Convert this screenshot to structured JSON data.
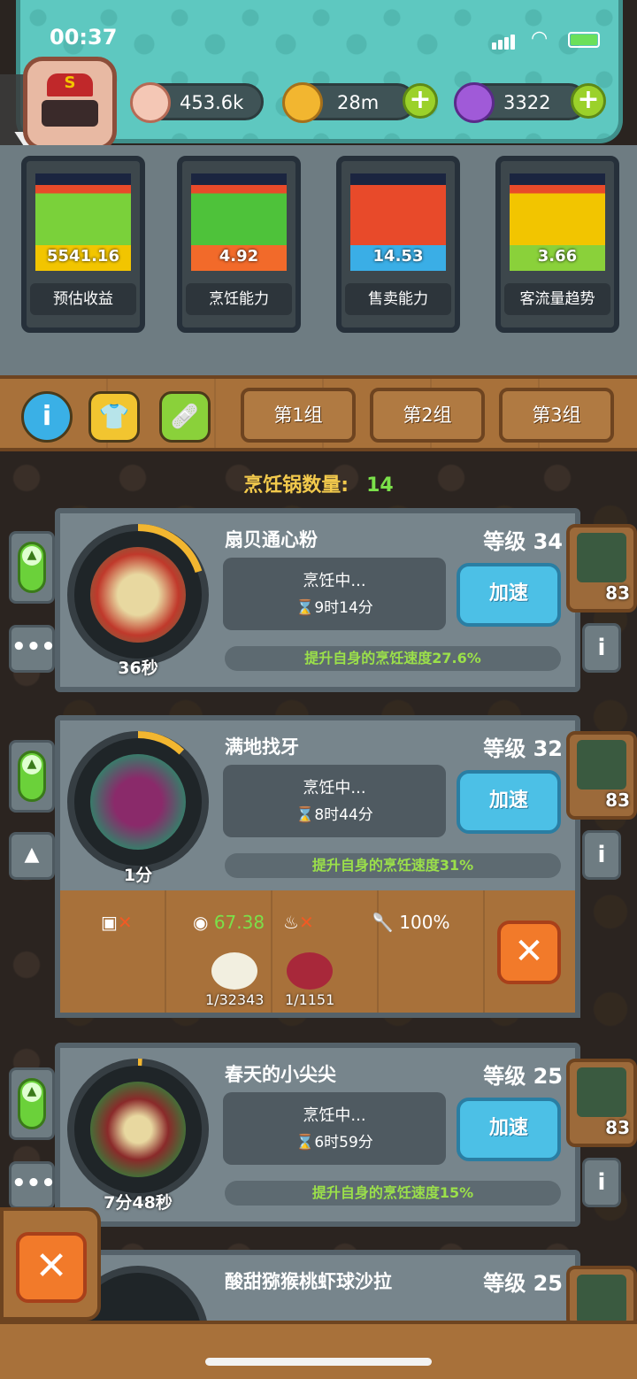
{
  "status_bar": {
    "time": "00:37"
  },
  "resources": [
    {
      "name": "eyeball",
      "icon": "eyeball-icon",
      "value": "453.6k",
      "color": "#f4c7b5"
    },
    {
      "name": "coins",
      "icon": "coin-icon",
      "value": "28m",
      "color": "#f2b630"
    },
    {
      "name": "potion",
      "icon": "potion-icon",
      "value": "3322",
      "color": "#a05ad8"
    }
  ],
  "gauges": [
    {
      "value": "5541.16",
      "label": "预估收益",
      "fill": 0.88,
      "colors": [
        "#f2c500",
        "#7ad13a"
      ]
    },
    {
      "value": "4.92",
      "label": "烹饪能力",
      "fill": 0.88,
      "colors": [
        "#f26a2a",
        "#4ec23a"
      ]
    },
    {
      "value": "14.53",
      "label": "售卖能力",
      "fill": 0.88,
      "colors": [
        "#3aaee6",
        "#e84a2a"
      ]
    },
    {
      "value": "3.66",
      "label": "客流量趋势",
      "fill": 0.88,
      "colors": [
        "#8ad13a",
        "#f2c500"
      ]
    }
  ],
  "groups": [
    "第1组",
    "第2组",
    "第3组"
  ],
  "pot_count": {
    "label": "烹饪锅数量:",
    "value": "14"
  },
  "dishes": [
    {
      "name": "扇贝通心粉",
      "level": "等级 34",
      "status": "烹饪中...",
      "time_left": "9时14分",
      "plate_time": "36秒",
      "speed_label": "加速",
      "buff": "提升自身的烹饪速度27.6%",
      "side_count": "83",
      "progress": 0.2
    },
    {
      "name": "满地找牙",
      "level": "等级 32",
      "status": "烹饪中...",
      "time_left": "8时44分",
      "plate_time": "1分",
      "speed_label": "加速",
      "buff": "提升自身的烹饪速度31%",
      "side_count": "83",
      "progress": 0.12
    },
    {
      "name": "春天的小尖尖",
      "level": "等级 25",
      "status": "烹饪中...",
      "time_left": "6时59分",
      "plate_time": "7分48秒",
      "speed_label": "加速",
      "buff": "提升自身的烹饪速度15%",
      "side_count": "83",
      "progress": 0.01
    },
    {
      "name": "酸甜猕猴桃虾球沙拉",
      "level": "等级 25",
      "side_count": ""
    }
  ],
  "detail": {
    "eye_value": "67.38",
    "quality": "100%",
    "requirements": [
      "1/32343",
      "1/1151"
    ]
  }
}
